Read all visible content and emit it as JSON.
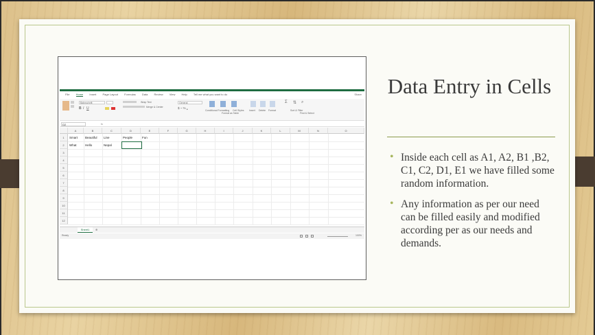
{
  "slide": {
    "title": "Data Entry in Cells",
    "bullets": [
      "Inside each cell as A1, A2, B1 ,B2, C1, C2, D1, E1 we have filled some random information.",
      "Any information as per our need can be filled easily and modified according per as our needs and demands."
    ],
    "bullet_icon": "bullet-dot-icon",
    "accent_color": "#a7b65e",
    "rule_color": "#8a9a4b"
  },
  "excel": {
    "menu": [
      "File",
      "Home",
      "Insert",
      "Page Layout",
      "Formulas",
      "Data",
      "Review",
      "View",
      "Help",
      "Tell me what you want to do"
    ],
    "share": "Share",
    "ribbon": {
      "font_name": "Bahnschrift",
      "wrap_text": "Wrap Text",
      "merge": "Merge & Center",
      "number_format": "General",
      "conditional": "Conditional Formatting",
      "format_table": "Format as Table",
      "cell_styles": "Cell Styles",
      "insert": "Insert",
      "delete": "Delete",
      "format": "Format",
      "sort": "Sort & Filter",
      "find": "Find & Select"
    },
    "name_box": "D2",
    "fx": "fx",
    "columns": [
      "A",
      "B",
      "C",
      "D",
      "E",
      "F",
      "G",
      "H",
      "I",
      "J",
      "K",
      "L",
      "M",
      "N",
      "O"
    ],
    "rows": [
      "1",
      "2",
      "3",
      "4",
      "5",
      "6",
      "7",
      "8",
      "9",
      "10",
      "11",
      "12"
    ],
    "cells": {
      "A1": "Smart",
      "B1": "Beautiful",
      "C1": "Line",
      "D1": "People",
      "E1": "Fun",
      "A2": "What",
      "B2": "Hello",
      "C2": "Nepal"
    },
    "sheet_tab": "Sheet1",
    "status": "Ready",
    "zoom": "100%",
    "accent_color": "#1e6c41"
  }
}
